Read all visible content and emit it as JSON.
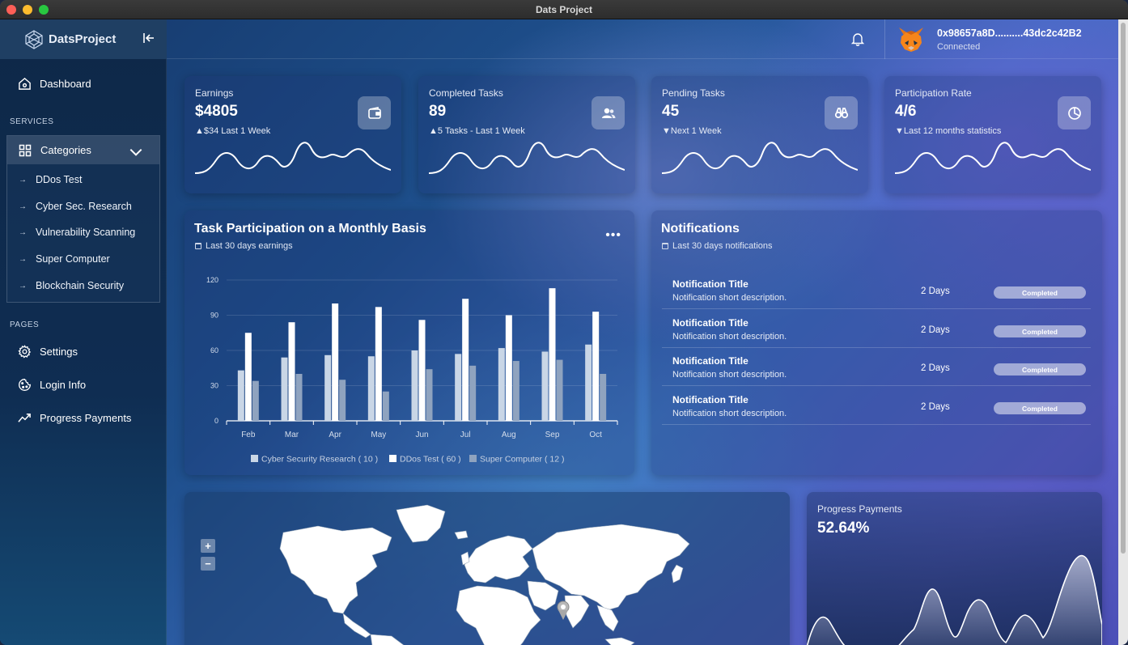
{
  "window": {
    "title": "Dats Project"
  },
  "sidebar": {
    "brand": "DatsProject",
    "dashboard": "Dashboard",
    "services_label": "SERVICES",
    "categories_label": "Categories",
    "categories": [
      {
        "label": "DDos Test"
      },
      {
        "label": "Cyber Sec. Research"
      },
      {
        "label": "Vulnerability Scanning"
      },
      {
        "label": "Super Computer"
      },
      {
        "label": "Blockchain Security"
      }
    ],
    "pages_label": "PAGES",
    "pages": [
      {
        "label": "Settings",
        "icon": "gear-icon"
      },
      {
        "label": "Login Info",
        "icon": "cookie-icon"
      },
      {
        "label": "Progress Payments",
        "icon": "trend-icon"
      }
    ]
  },
  "header": {
    "wallet_address": "0x98657a8D..........43dc2c42B2",
    "wallet_status": "Connected"
  },
  "stats": [
    {
      "title": "Earnings",
      "value": "$4805",
      "trend": "$34 Last 1 Week",
      "direction": "up",
      "icon": "wallet-icon"
    },
    {
      "title": "Completed Tasks",
      "value": "89",
      "trend": "5 Tasks - Last 1 Week",
      "direction": "up",
      "icon": "users-icon"
    },
    {
      "title": "Pending Tasks",
      "value": "45",
      "trend": "Next 1 Week",
      "direction": "down",
      "icon": "binoculars-icon"
    },
    {
      "title": "Participation Rate",
      "value": "4/6",
      "trend": "Last 12 months statistics",
      "direction": "down",
      "icon": "pie-icon"
    }
  ],
  "task_chart": {
    "title": "Task Participation on a Monthly Basis",
    "subtitle": "Last 30 days earnings"
  },
  "chart_data": {
    "type": "bar",
    "categories": [
      "Feb",
      "Mar",
      "Apr",
      "May",
      "Jun",
      "Jul",
      "Aug",
      "Sep",
      "Oct"
    ],
    "series": [
      {
        "name": "Cyber Security Research ( 10 )",
        "values": [
          43,
          54,
          56,
          55,
          60,
          57,
          62,
          59,
          65
        ]
      },
      {
        "name": "DDos Test ( 60 )",
        "values": [
          75,
          84,
          100,
          97,
          86,
          104,
          90,
          113,
          93
        ]
      },
      {
        "name": "Super Computer ( 12 )",
        "values": [
          34,
          40,
          35,
          25,
          44,
          47,
          51,
          52,
          40
        ]
      }
    ],
    "yticks": [
      "0",
      "30",
      "60",
      "90",
      "120"
    ],
    "ylim": [
      0,
      120
    ],
    "colors": [
      "#c9d6e6",
      "#ffffff",
      "#8fa3bf"
    ],
    "grid": true,
    "legend": "bottom"
  },
  "notifications": {
    "title": "Notifications",
    "subtitle": "Last 30 days notifications",
    "items": [
      {
        "title": "Notification Title",
        "desc": "Notification short description.",
        "time": "2 Days",
        "status": "Completed"
      },
      {
        "title": "Notification Title",
        "desc": "Notification short description.",
        "time": "2 Days",
        "status": "Completed"
      },
      {
        "title": "Notification Title",
        "desc": "Notification short description.",
        "time": "2 Days",
        "status": "Completed"
      },
      {
        "title": "Notification Title",
        "desc": "Notification short description.",
        "time": "2 Days",
        "status": "Completed"
      }
    ]
  },
  "map": {
    "zoom_in": "+",
    "zoom_out": "−"
  },
  "progress": {
    "title": "Progress Payments",
    "value": "52.64%"
  }
}
